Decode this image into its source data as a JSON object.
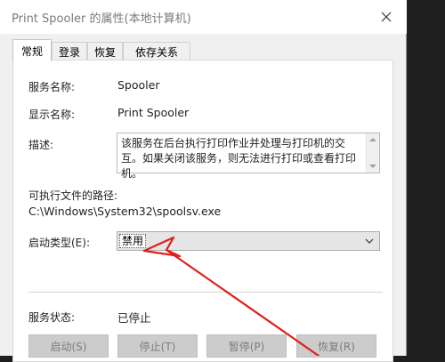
{
  "window": {
    "title": "Print Spooler 的属性(本地计算机)"
  },
  "tabs": [
    {
      "label": "常规",
      "active": true
    },
    {
      "label": "登录",
      "active": false
    },
    {
      "label": "恢复",
      "active": false
    },
    {
      "label": "依存关系",
      "active": false
    }
  ],
  "general": {
    "service_name_label": "服务名称:",
    "service_name_value": "Spooler",
    "display_name_label": "显示名称:",
    "display_name_value": "Print Spooler",
    "description_label": "描述:",
    "description_value": "该服务在后台执行打印作业并处理与打印机的交互。如果关闭该服务，则无法进行打印或查看打印机。",
    "path_label": "可执行文件的路径:",
    "path_value": "C:\\Windows\\System32\\spoolsv.exe",
    "startup_type_label": "启动类型(E):",
    "startup_type_value": "禁用",
    "status_label": "服务状态:",
    "status_value": "已停止"
  },
  "buttons": {
    "start": "启动(S)",
    "stop": "停止(T)",
    "pause": "暂停(P)",
    "resume": "恢复(R)"
  },
  "icons": {
    "close": "close-icon",
    "dropdown": "chevron-down-icon",
    "scroll_up": "scroll-up-icon",
    "scroll_down": "scroll-down-icon"
  },
  "colors": {
    "annotation_arrow": "#e0201c",
    "disabled_button_bg": "#cccccc",
    "dialog_bg": "#f0f0f0"
  }
}
